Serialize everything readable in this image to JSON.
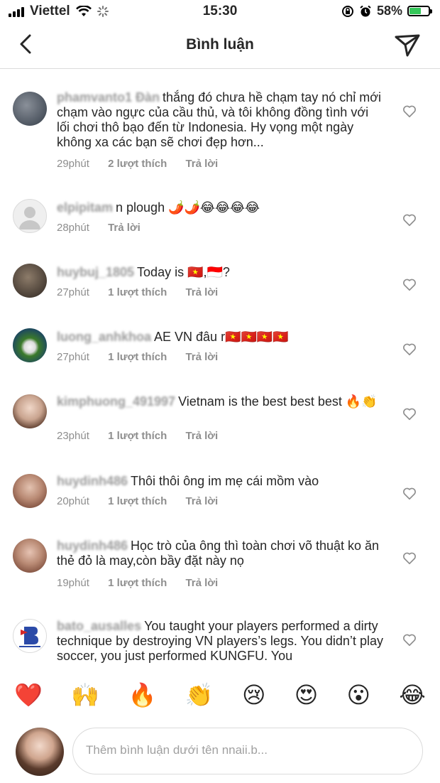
{
  "status_bar": {
    "carrier": "Viettel",
    "time": "15:30",
    "battery": "58%",
    "battery_level": 0.58
  },
  "header": {
    "title": "Bình luận"
  },
  "comments": [
    {
      "username": "phamvanto1 Đàn",
      "text": "thắng đó chưa hề chạm tay nó chỉ mới chạm vào ngực của cầu thủ, và tôi không đồng tình với lối chơi thô bạo đến từ Indonesia.  Hy vọng một ngày không xa các bạn sẽ chơi đẹp hơn...",
      "time": "29phút",
      "likes": "2 lượt thích",
      "reply": "Trả lời"
    },
    {
      "username": "elpipitam",
      "text": "n plough 🌶️🌶️😂😂😂😂",
      "time": "28phút",
      "likes": "",
      "reply": "Trả lời"
    },
    {
      "username": "huybuj_1805",
      "text": "Today is 🇻🇳,🇮🇩?",
      "time": "27phút",
      "likes": "1 lượt thích",
      "reply": "Trả lời"
    },
    {
      "username": "luong_anhkhoa",
      "text": "AE VN đâu r🇻🇳🇻🇳🇻🇳🇻🇳",
      "time": "27phút",
      "likes": "1 lượt thích",
      "reply": "Trả lời"
    },
    {
      "username": "kimphuong_491997",
      "text": "Vietnam is the best best best 🔥👏",
      "time": "23phút",
      "likes": "1 lượt thích",
      "reply": "Trả lời"
    },
    {
      "username": "huydinh486",
      "text": "Thôi thôi ông im mẹ cái mồm vào",
      "time": "20phút",
      "likes": "1 lượt thích",
      "reply": "Trả lời"
    },
    {
      "username": "huydinh486",
      "text": "Học trò của ông thì toàn chơi võ thuật ko ăn thẻ đỏ là may,còn bầy đặt này nọ",
      "time": "19phút",
      "likes": "1 lượt thích",
      "reply": "Trả lời"
    },
    {
      "username": "bato_ausalles",
      "text": "You taught your players performed a dirty technique by destroying VN players’s legs. You didn’t play soccer, you just performed KUNGFU. You",
      "time": "",
      "likes": "",
      "reply": ""
    }
  ],
  "emoji_bar": [
    "❤️",
    "🙌",
    "🔥",
    "👏",
    "😢",
    "😍",
    "😮",
    "😂"
  ],
  "footer": {
    "placeholder": "Thêm bình luận dưới tên nnaii.b..."
  },
  "colors": {
    "text": "#262626",
    "meta": "#8e8e8e",
    "divider": "#dbdbdb",
    "battery": "#34c759"
  }
}
